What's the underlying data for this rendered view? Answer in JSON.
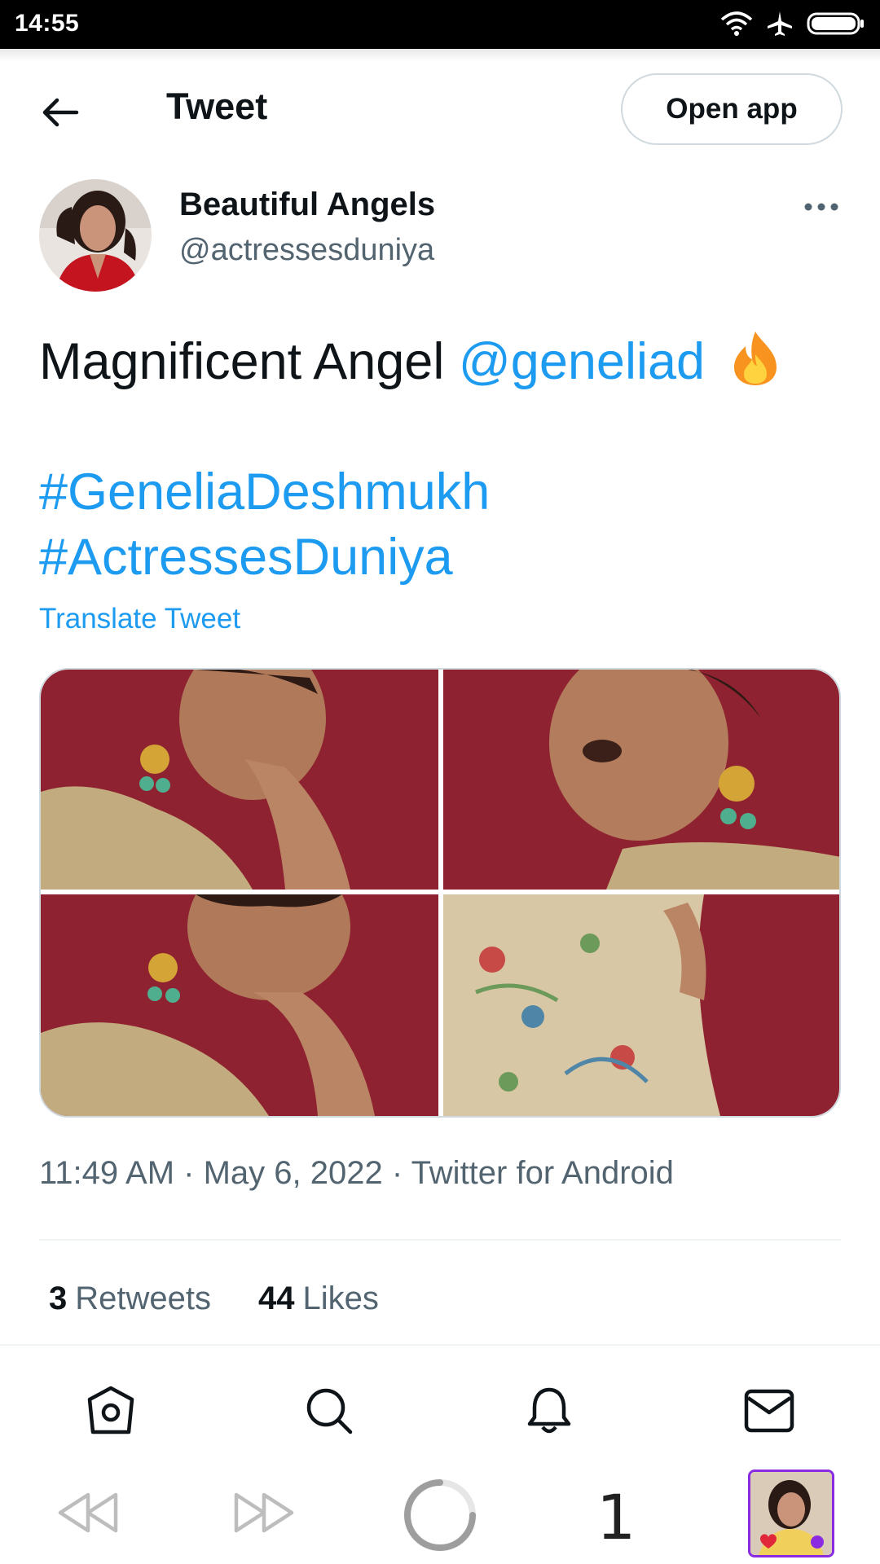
{
  "status_bar": {
    "time": "14:55"
  },
  "header": {
    "back_icon": "arrow-left-icon",
    "title": "Tweet",
    "open_app_label": "Open app"
  },
  "author": {
    "name": "Beautiful Angels",
    "handle": "@actressesduniya",
    "more_icon": "more-horizontal-icon"
  },
  "tweet": {
    "text_plain": "Magnificent Angel",
    "mention": "@geneliad",
    "hashtags": [
      "#GeneliaDeshmukh",
      "#ActressesDuniya"
    ],
    "translate_label": "Translate Tweet"
  },
  "media": {
    "count": 4
  },
  "meta": {
    "time": "11:49 AM",
    "date": "May 6, 2022",
    "source": "Twitter for Android"
  },
  "stats": {
    "retweets_count": "3",
    "retweets_label": "Retweets",
    "likes_count": "44",
    "likes_label": "Likes"
  },
  "tab_bar": {
    "items": [
      "home-icon",
      "search-icon",
      "notifications-icon",
      "messages-icon"
    ]
  },
  "browser_bar": {
    "tab_count": "1"
  },
  "colors": {
    "link": "#1d9bf0",
    "secondary_text": "#536471",
    "photo_bg": "#8f2230"
  }
}
